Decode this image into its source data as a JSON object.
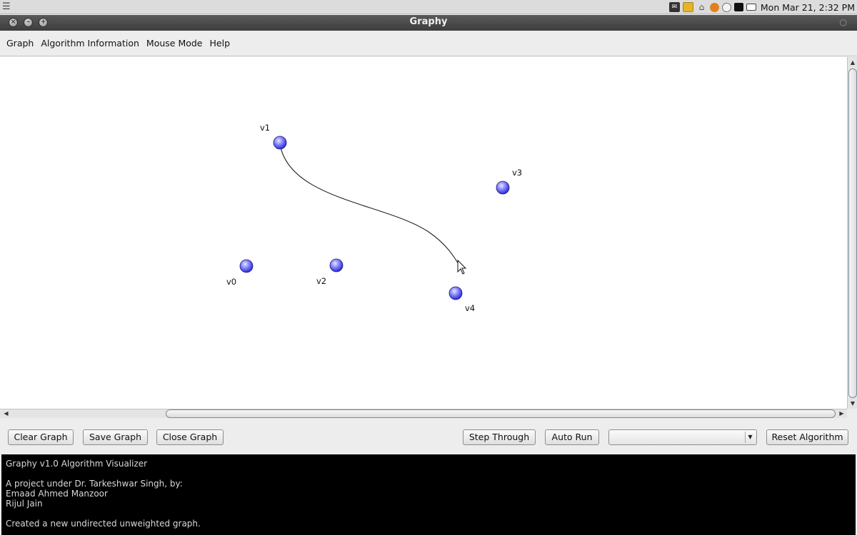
{
  "system_panel": {
    "clock": "Mon Mar 21,  2:32 PM",
    "icons": [
      "menu-icon",
      "mail-icon",
      "folder-icon",
      "network-icon",
      "update-icon",
      "status-icon",
      "battery-icon",
      "keyboard-icon"
    ]
  },
  "window": {
    "title": "Graphy"
  },
  "menubar": {
    "items": [
      "Graph",
      "Algorithm Information",
      "Mouse Mode",
      "Help"
    ]
  },
  "graph": {
    "vertices": [
      {
        "label": "v0"
      },
      {
        "label": "v1"
      },
      {
        "label": "v2"
      },
      {
        "label": "v3"
      },
      {
        "label": "v4"
      }
    ],
    "vertex_color": "#5a5aff",
    "edge_color": "#222222"
  },
  "buttons": {
    "clear_graph": "Clear Graph",
    "save_graph": "Save Graph",
    "close_graph": "Close Graph",
    "step_through": "Step Through",
    "auto_run": "Auto Run",
    "reset_algorithm": "Reset Algorithm"
  },
  "algorithm_select": {
    "selected": ""
  },
  "console": {
    "lines": [
      "Graphy v1.0 Algorithm Visualizer",
      "",
      "A project under Dr. Tarkeshwar Singh, by:",
      "Emaad Ahmed Manzoor",
      "Rijul Jain",
      "",
      "Created a new undirected unweighted graph."
    ]
  }
}
